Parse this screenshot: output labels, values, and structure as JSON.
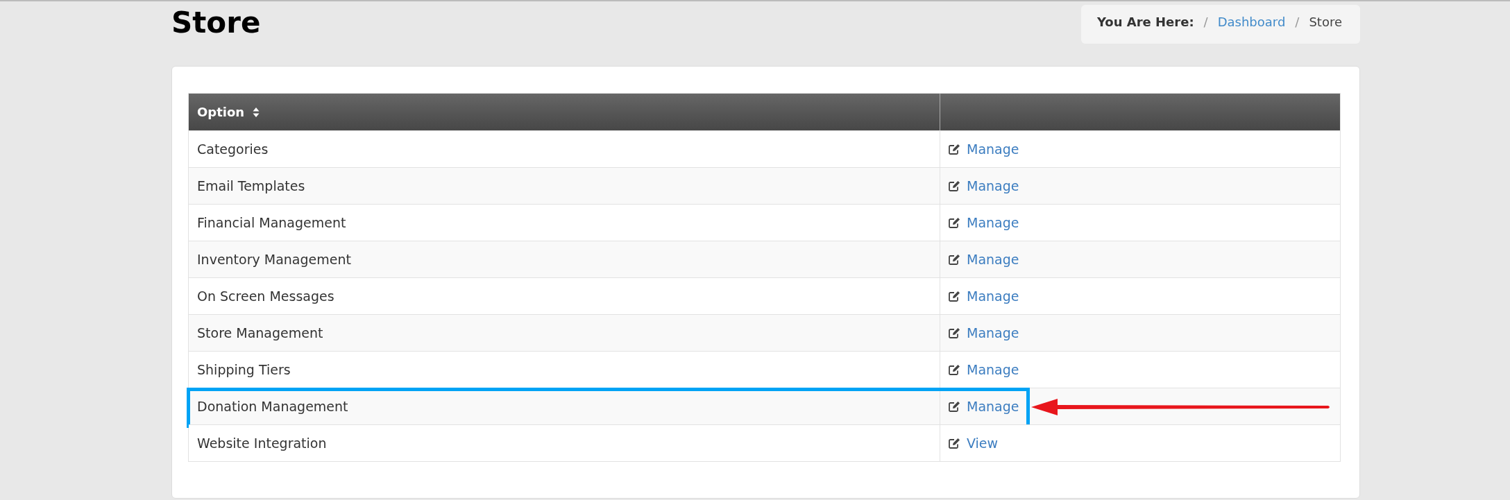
{
  "page_title": "Store",
  "breadcrumb": {
    "label": "You Are Here:",
    "separator": "/",
    "items": [
      {
        "label": "Dashboard",
        "kind": "link"
      },
      {
        "label": "Store",
        "kind": "current"
      }
    ]
  },
  "table": {
    "columns": [
      {
        "label": "Option",
        "sortable": true
      }
    ],
    "rows": [
      {
        "option": "Categories",
        "action": "Manage",
        "highlighted": false
      },
      {
        "option": "Email Templates",
        "action": "Manage",
        "highlighted": false
      },
      {
        "option": "Financial Management",
        "action": "Manage",
        "highlighted": false
      },
      {
        "option": "Inventory Management",
        "action": "Manage",
        "highlighted": false
      },
      {
        "option": "On Screen Messages",
        "action": "Manage",
        "highlighted": false
      },
      {
        "option": "Store Management",
        "action": "Manage",
        "highlighted": false
      },
      {
        "option": "Shipping Tiers",
        "action": "Manage",
        "highlighted": false
      },
      {
        "option": "Donation Management",
        "action": "Manage",
        "highlighted": true
      },
      {
        "option": "Website Integration",
        "action": "View",
        "highlighted": false
      }
    ]
  }
}
